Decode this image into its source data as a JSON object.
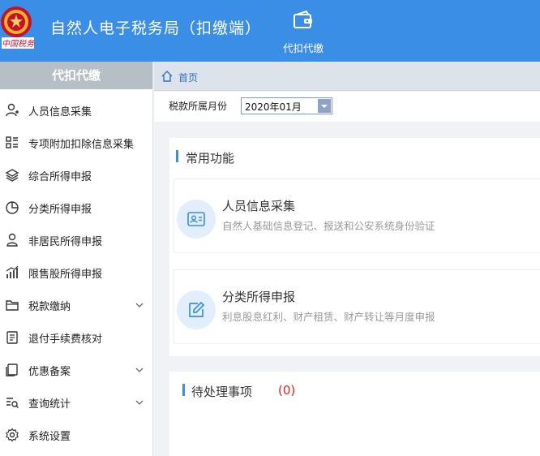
{
  "header": {
    "emblem_text": "中国税务",
    "title": "自然人电子税务局（扣缴端）",
    "nav": [
      {
        "label": "代扣代缴",
        "icon": "wallet-icon"
      }
    ]
  },
  "sidebar": {
    "header": "代扣代缴",
    "items": [
      {
        "label": "人员信息采集",
        "icon": "person-add-icon",
        "expandable": false
      },
      {
        "label": "专项附加扣除信息采集",
        "icon": "list-icon",
        "expandable": false
      },
      {
        "label": "综合所得申报",
        "icon": "layers-icon",
        "expandable": false
      },
      {
        "label": "分类所得申报",
        "icon": "pie-chart-icon",
        "expandable": false
      },
      {
        "label": "非居民所得申报",
        "icon": "person-outline-icon",
        "expandable": false
      },
      {
        "label": "限售股所得申报",
        "icon": "bar-chart-icon",
        "expandable": false
      },
      {
        "label": "税款缴纳",
        "icon": "folder-icon",
        "expandable": true
      },
      {
        "label": "退付手续费核对",
        "icon": "document-check-icon",
        "expandable": false
      },
      {
        "label": "优惠备案",
        "icon": "copy-icon",
        "expandable": true
      },
      {
        "label": "查询统计",
        "icon": "search-list-icon",
        "expandable": true
      },
      {
        "label": "系统设置",
        "icon": "gear-icon",
        "expandable": false
      }
    ]
  },
  "breadcrumb": {
    "home": "首页"
  },
  "filter": {
    "label": "税款所属月份",
    "value": "2020年01月"
  },
  "common": {
    "title": "常用功能",
    "cards": [
      {
        "title": "人员信息采集",
        "desc": "自然人基础信息登记、报送和公安系统身份验证",
        "icon": "id-card-icon"
      },
      {
        "title": "分类所得申报",
        "desc": "利息股息红利、财产租赁、财产转让等月度申报",
        "icon": "edit-icon"
      }
    ]
  },
  "pending": {
    "title": "待处理事项",
    "count": "(0)"
  },
  "colors": {
    "header_bg": "#3a8ee6",
    "sidebar_header_bg": "#b7bfc6",
    "accent": "#3a8ee6",
    "pending_count": "#e02020"
  }
}
